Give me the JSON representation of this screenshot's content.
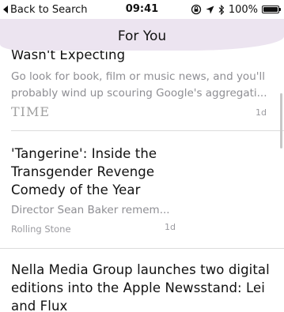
{
  "status_bar": {
    "back_label": "Back to Search",
    "time": "09:41",
    "battery_text": "100%",
    "battery_level": 1.0
  },
  "nav": {
    "title": "For You"
  },
  "articles": [
    {
      "headline": "Wasn't Expecting",
      "summary_line1": "Go look for book, film or music news, and you'll",
      "summary_line2": "probably wind up scouring Google's aggregati...",
      "source": "TIME",
      "age": "1d"
    },
    {
      "headline_line1": "'Tangerine': Inside the",
      "headline_line2": "Transgender Revenge",
      "headline_line3": "Comedy of the Year",
      "summary": "Director Sean Baker remem...",
      "source": "Rolling Stone",
      "age": "1d"
    },
    {
      "headline_line1": "Nella Media Group launches two digital",
      "headline_line2": "editions into the Apple Newsstand: Lei",
      "headline_line3": "and Flux"
    }
  ]
}
